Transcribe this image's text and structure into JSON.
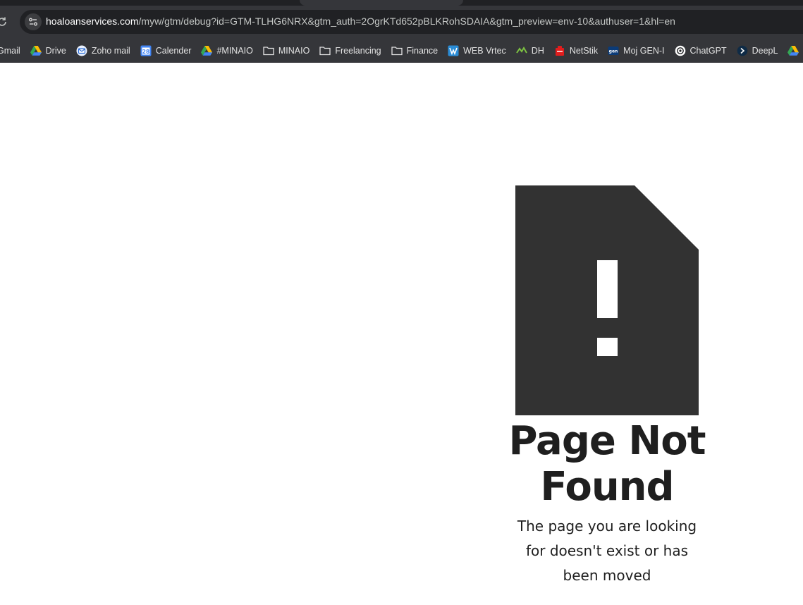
{
  "browser": {
    "url_host": "hoaloanservices.com",
    "url_rest": "/myw/gtm/debug?id=GTM-TLHG6NRX&gtm_auth=2OgrKTd652pBLKRohSDAIA&gtm_preview=env-10&authuser=1&hl=en",
    "bookmarks": [
      {
        "label": "Gmail",
        "icon": "gmail-icon"
      },
      {
        "label": "Drive",
        "icon": "google-drive-icon"
      },
      {
        "label": "Zoho mail",
        "icon": "zoho-mail-icon"
      },
      {
        "label": "Calender",
        "icon": "google-calendar-icon"
      },
      {
        "label": "#MINAIO",
        "icon": "google-drive-icon"
      },
      {
        "label": "MINAIO",
        "icon": "folder-icon"
      },
      {
        "label": "Freelancing",
        "icon": "folder-icon"
      },
      {
        "label": "Finance",
        "icon": "folder-icon"
      },
      {
        "label": "WEB Vrtec",
        "icon": "web-vrtec-icon"
      },
      {
        "label": "DH",
        "icon": "dh-icon"
      },
      {
        "label": "NetStik",
        "icon": "netstik-icon"
      },
      {
        "label": "Moj GEN-I",
        "icon": "gen-i-icon"
      },
      {
        "label": "ChatGPT",
        "icon": "chatgpt-icon"
      },
      {
        "label": "DeepL",
        "icon": "deepl-icon"
      }
    ]
  },
  "error": {
    "title": "Page Not Found",
    "message": "The page you are looking for doesn't exist or has been moved",
    "icon": "document-exclamation-icon"
  },
  "colors": {
    "chrome_bg": "#35363a",
    "omnibox_bg": "#202124",
    "icon_fill": "#323232",
    "text": "#1f1f1f"
  }
}
